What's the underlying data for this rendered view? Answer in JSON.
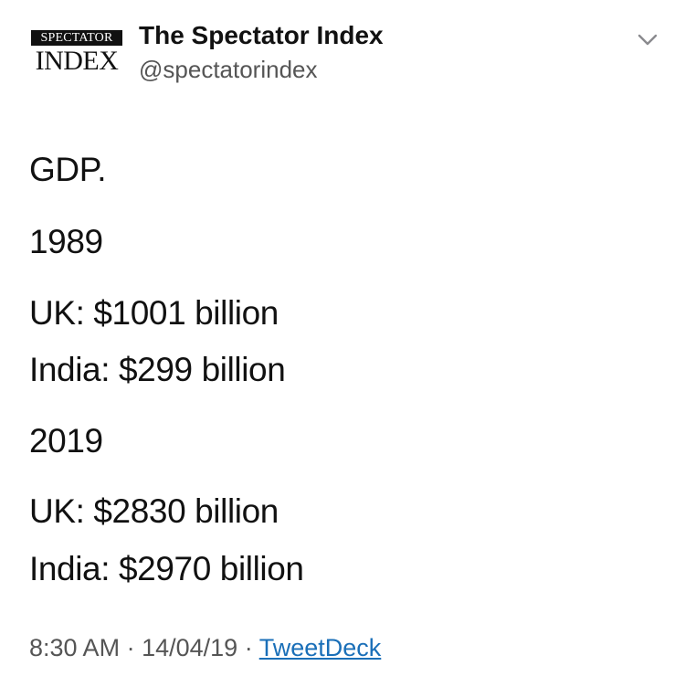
{
  "header": {
    "logo": {
      "top_text": "SPECTATOR",
      "bottom_text": "INDEX"
    },
    "display_name": "The Spectator Index",
    "handle": "@spectatorindex",
    "menu_icon": "chevron-down-icon"
  },
  "tweet": {
    "lines": [
      "GDP.",
      "1989",
      "UK: $1001 billion",
      "India: $299 billion",
      "2019",
      "UK: $2830 billion",
      "India: $2970 billion"
    ]
  },
  "meta": {
    "time": "8:30 AM",
    "separator": "·",
    "date": "14/04/19",
    "source": "TweetDeck"
  },
  "colors": {
    "text": "#111111",
    "secondary": "#555555",
    "link": "#1a6fb8"
  }
}
